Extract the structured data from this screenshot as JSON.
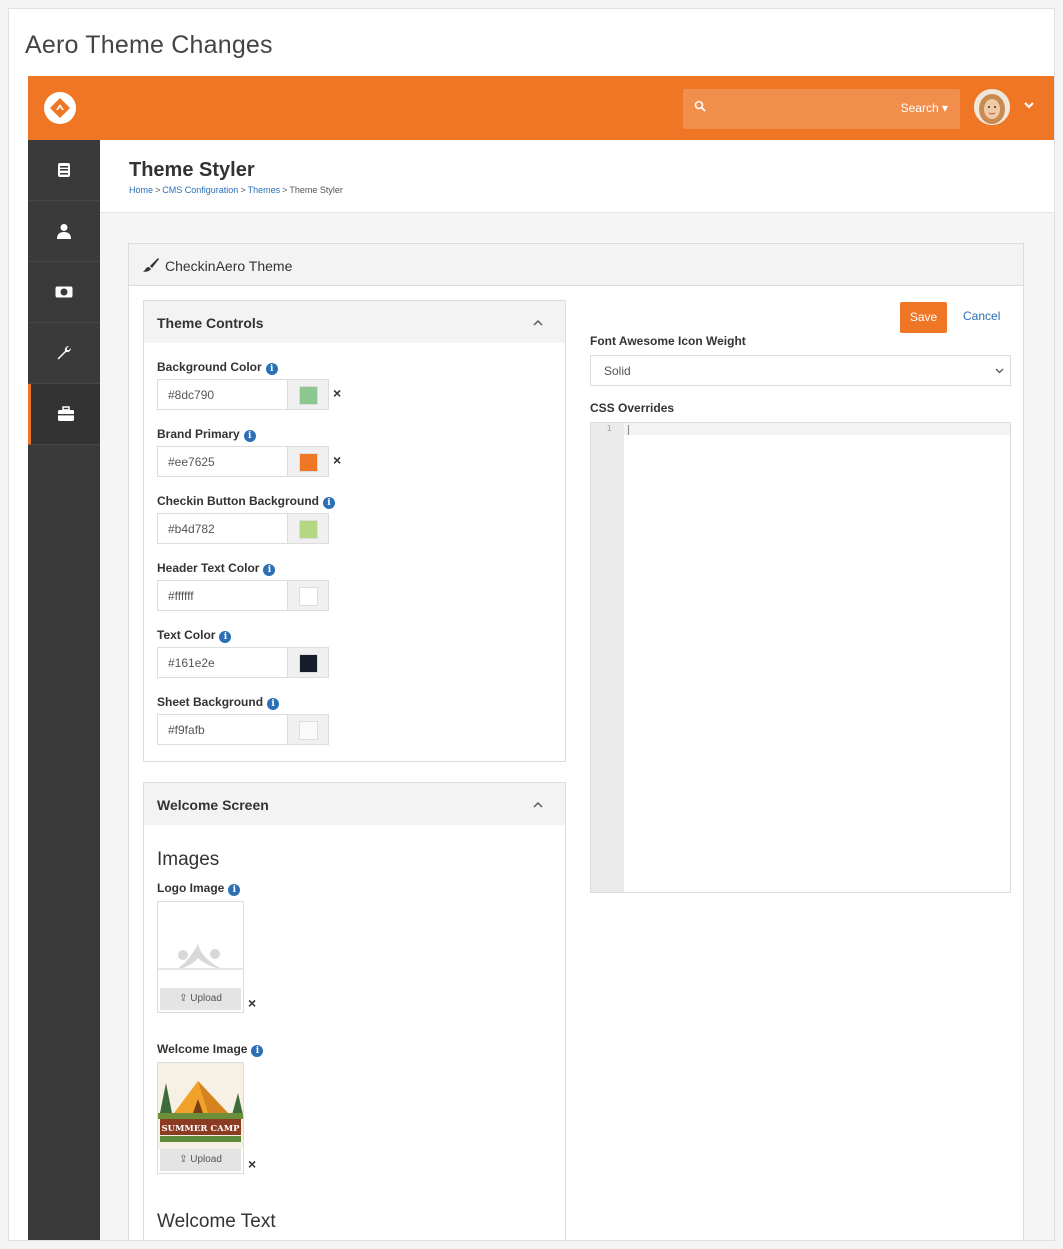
{
  "doc_title": "Aero Theme Changes",
  "topbar": {
    "search_label": "Search ▾",
    "colors": {
      "brand": "#ee7625"
    }
  },
  "sidebar": {
    "items": [
      {
        "icon": "book-icon"
      },
      {
        "icon": "person-icon"
      },
      {
        "icon": "money-icon"
      },
      {
        "icon": "wrench-icon"
      },
      {
        "icon": "briefcase-icon",
        "active": true
      }
    ]
  },
  "page": {
    "title": "Theme Styler",
    "breadcrumb": [
      "Home",
      "CMS Configuration",
      "Themes",
      "Theme Styler"
    ],
    "breadcrumb_sep": ">"
  },
  "card": {
    "title": "CheckinAero Theme"
  },
  "theme_controls": {
    "title": "Theme Controls",
    "fields": [
      {
        "label": "Background Color",
        "value": "#8dc790",
        "swatch": "#8dc790",
        "clearable": true
      },
      {
        "label": "Brand Primary",
        "value": "#ee7625",
        "swatch": "#ee7625",
        "clearable": true
      },
      {
        "label": "Checkin Button Background",
        "value": "#b4d782",
        "swatch": "#b4d782",
        "clearable": false
      },
      {
        "label": "Header Text Color",
        "value": "#ffffff",
        "swatch": "#ffffff",
        "clearable": false
      },
      {
        "label": "Text Color",
        "value": "#161e2e",
        "swatch": "#161e2e",
        "clearable": false
      },
      {
        "label": "Sheet Background",
        "value": "#f9fafb",
        "swatch": "#f9fafb",
        "clearable": false
      }
    ]
  },
  "welcome_screen": {
    "title": "Welcome Screen",
    "images_heading": "Images",
    "logo_label": "Logo Image",
    "welcome_label": "Welcome Image",
    "upload_label": "Upload",
    "welcome_text_heading": "Welcome Text",
    "camp_text": "SUMMER CAMP"
  },
  "actions": {
    "save": "Save",
    "cancel": "Cancel"
  },
  "font_weight": {
    "label": "Font Awesome Icon Weight",
    "value": "Solid"
  },
  "css_overrides": {
    "label": "CSS Overrides",
    "line_number": "1"
  },
  "close_glyph": "×"
}
